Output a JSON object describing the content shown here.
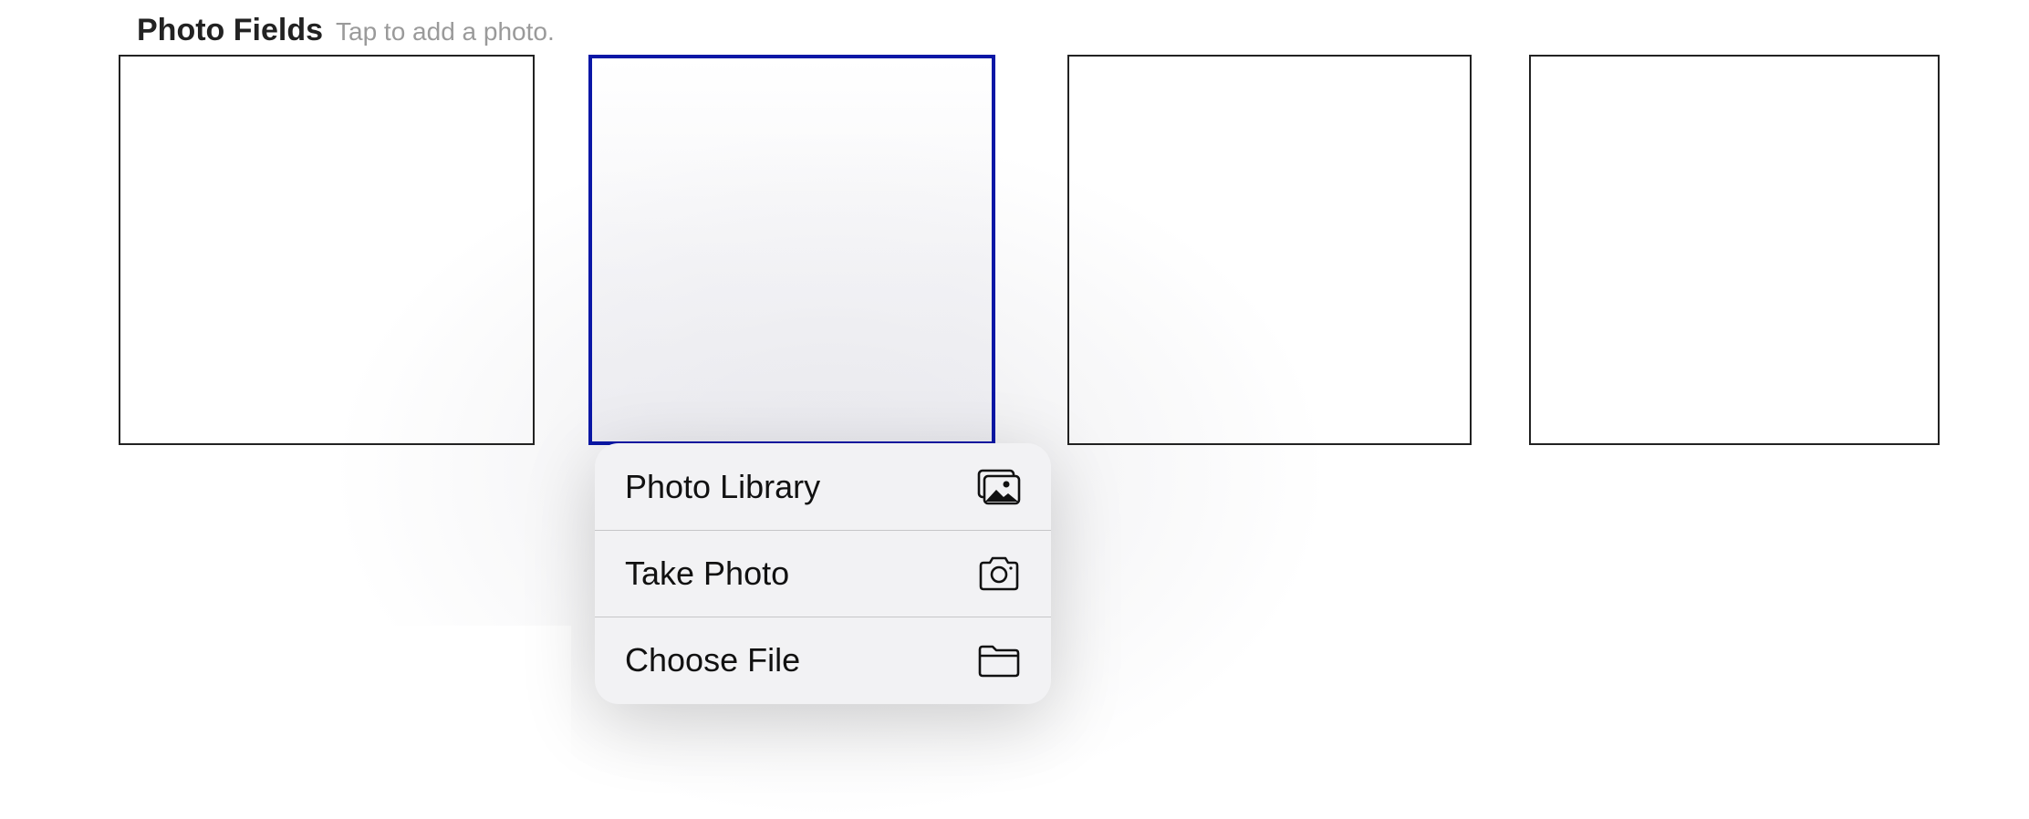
{
  "header": {
    "title": "Photo Fields",
    "hint": "Tap to add a photo."
  },
  "photo_fields": [
    {
      "selected": false
    },
    {
      "selected": true
    },
    {
      "selected": false
    },
    {
      "selected": false
    }
  ],
  "menu": {
    "items": [
      {
        "label": "Photo Library",
        "icon": "photo-library-icon"
      },
      {
        "label": "Take Photo",
        "icon": "camera-icon"
      },
      {
        "label": "Choose File",
        "icon": "folder-icon"
      }
    ]
  },
  "colors": {
    "selected_border": "#0a17a6",
    "popover_bg": "#f2f2f4",
    "hint_text": "#9a9a9a"
  }
}
